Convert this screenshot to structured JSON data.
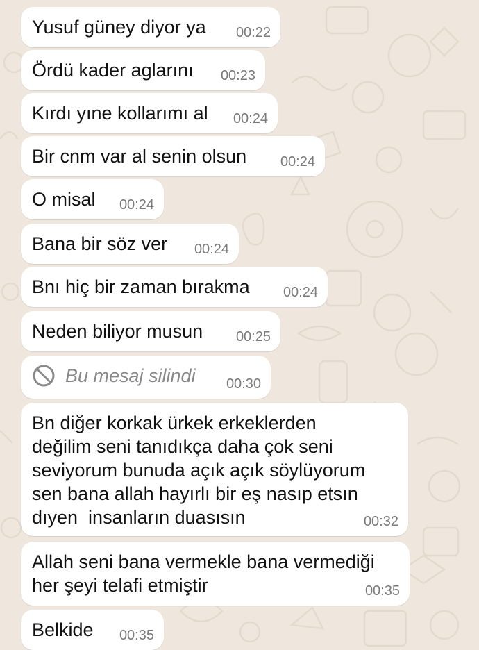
{
  "chat": {
    "background_color": "#efe7de",
    "bubble_color": "#ffffff",
    "messages": [
      {
        "text": "Yusuf güney diyor ya",
        "time": "00:22"
      },
      {
        "text": "Ördü kader aglarını",
        "time": "00:23"
      },
      {
        "text": "Kırdı yıne kollarımı al",
        "time": "00:24"
      },
      {
        "text": "Bir cnm var al senin olsun",
        "time": "00:24"
      },
      {
        "text": "O misal",
        "time": "00:24"
      },
      {
        "text": "Bana bir söz ver",
        "time": "00:24"
      },
      {
        "text": "Bnı hiç bir zaman bırakma",
        "time": "00:24"
      },
      {
        "text": "Neden biliyor musun",
        "time": "00:25"
      },
      {
        "text": "Bu mesaj silindi",
        "time": "00:30",
        "icon": "deleted-message-icon"
      },
      {
        "text": "Bn diğer korkak ürkek erkeklerden\ndeğilim seni tanıdıkça daha çok seni\nseviyorum bunuda açık açık söylüyorum\nsen bana allah hayırlı bir eş nasıp etsın\ndıyen  insanların duasısın",
        "time": "00:32"
      },
      {
        "text": "Allah seni bana vermekle bana vermediği\nher şeyi telafi etmiştir",
        "time": "00:35"
      },
      {
        "text": "Belkide",
        "time": "00:35"
      }
    ]
  }
}
